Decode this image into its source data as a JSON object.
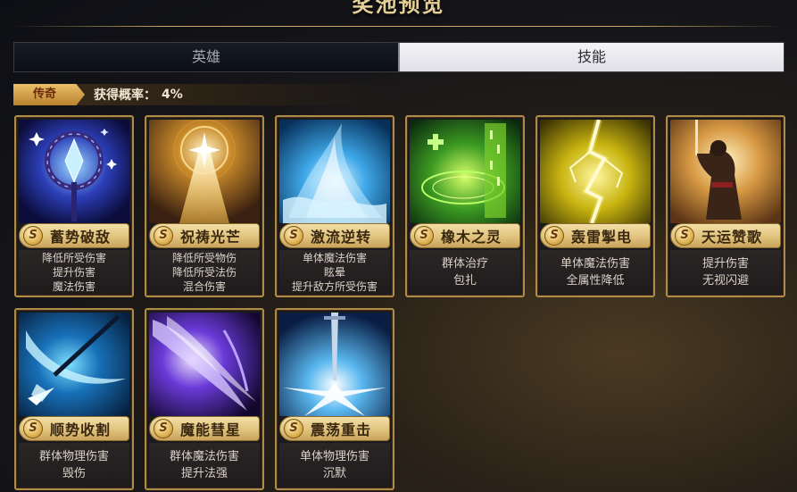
{
  "header": {
    "title": "奖池预览"
  },
  "tabs": [
    {
      "label": "英雄",
      "active": false
    },
    {
      "label": "技能",
      "active": true
    }
  ],
  "rate": {
    "rarity": "传奇",
    "label": "获得概率：",
    "value": "4%"
  },
  "colors": {
    "accent_gold": "#b08a48",
    "active_tab": "#f4f3f5",
    "rarity_badge": "#e9c068"
  },
  "skills": [
    {
      "grade": "S",
      "name": "蓄势破敌",
      "effects": [
        "降低所受伤害",
        "提升伤害",
        "魔法伤害"
      ],
      "icon": "crystal-staff-icon"
    },
    {
      "grade": "S",
      "name": "祝祷光芒",
      "effects": [
        "降低所受物伤",
        "降低所受法伤",
        "混合伤害"
      ],
      "icon": "holy-light-beam-icon"
    },
    {
      "grade": "S",
      "name": "激流逆转",
      "effects": [
        "单体魔法伤害",
        "眩晕",
        "提升敌方所受伤害"
      ],
      "icon": "water-torrent-icon"
    },
    {
      "grade": "S",
      "name": "橡木之灵",
      "effects": [
        "群体治疗",
        "包扎"
      ],
      "icon": "nature-rune-icon"
    },
    {
      "grade": "S",
      "name": "轰雷掣电",
      "effects": [
        "单体魔法伤害",
        "全属性降低"
      ],
      "icon": "lightning-bolt-icon"
    },
    {
      "grade": "S",
      "name": "天运赞歌",
      "effects": [
        "提升伤害",
        "无视闪避"
      ],
      "icon": "raised-sword-knight-icon"
    },
    {
      "grade": "S",
      "name": "顺势收割",
      "effects": [
        "群体物理伤害",
        "毁伤"
      ],
      "icon": "scythe-slash-icon"
    },
    {
      "grade": "S",
      "name": "魔能彗星",
      "effects": [
        "群体魔法伤害",
        "提升法强"
      ],
      "icon": "magic-comet-icon"
    },
    {
      "grade": "S",
      "name": "震荡重击",
      "effects": [
        "单体物理伤害",
        "沉默"
      ],
      "icon": "sword-impact-icon"
    }
  ]
}
